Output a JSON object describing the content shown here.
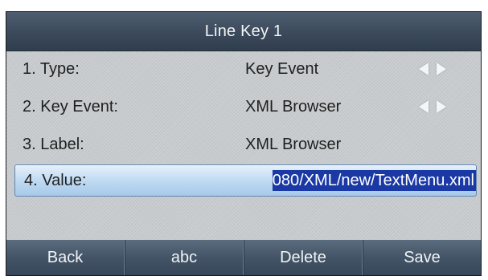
{
  "header": {
    "title": "Line Key 1"
  },
  "rows": [
    {
      "label": "1. Type:",
      "value": "Key Event",
      "has_arrows": true
    },
    {
      "label": "2. Key Event:",
      "value": "XML Browser",
      "has_arrows": true
    },
    {
      "label": "3. Label:",
      "value": "XML Browser",
      "has_arrows": false
    },
    {
      "label": "4. Value:",
      "value": "080/XML/new/TextMenu.xml",
      "selected": true
    }
  ],
  "softkeys": [
    "Back",
    "abc",
    "Delete",
    "Save"
  ],
  "colors": {
    "title_bar": "#3b4a5b",
    "selection_border": "#5d86b3",
    "text_highlight": "#1b39a5"
  },
  "icons": {
    "prev": "triangle-left-icon",
    "next": "triangle-right-icon"
  }
}
